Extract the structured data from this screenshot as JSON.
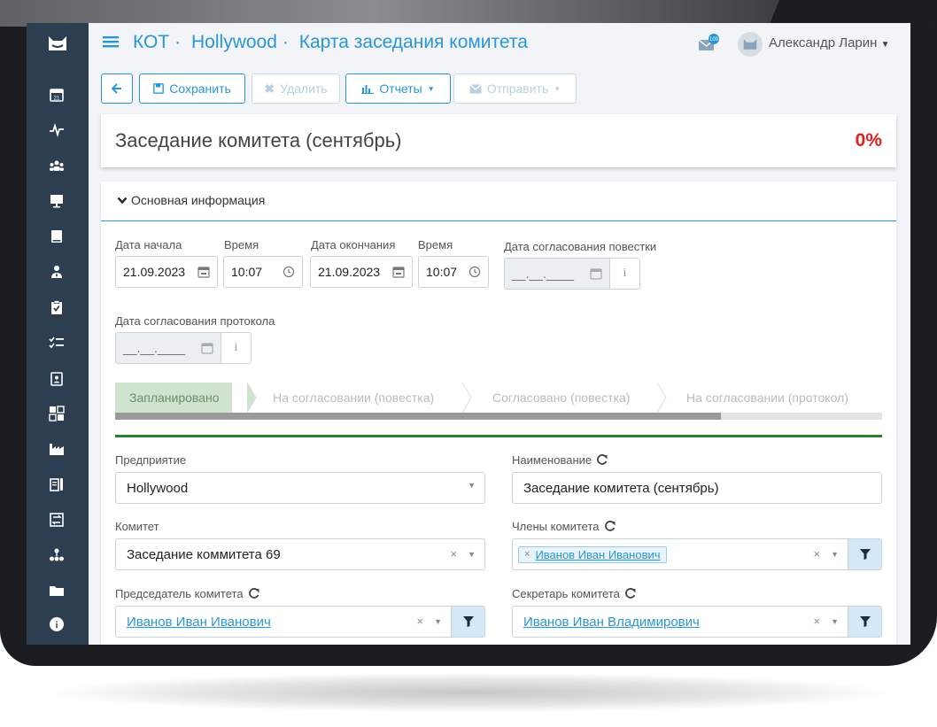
{
  "header": {
    "breadcrumb": [
      "КОТ",
      "Hollywood",
      "Карта заседания комитета"
    ],
    "mail_badge": "100",
    "user_name": "Александр Ларин"
  },
  "toolbar": {
    "save_label": "Сохранить",
    "delete_label": "Удалить",
    "reports_label": "Отчеты",
    "send_label": "Отправить"
  },
  "card": {
    "title": "Заседание комитета (сентябрь)",
    "progress_text": "0%"
  },
  "section": {
    "title": "Основная информация"
  },
  "dates": {
    "start_label": "Дата начала",
    "start_value": "21.09.2023",
    "time_label": "Время",
    "start_time": "10:07",
    "end_label": "Дата окончания",
    "end_value": "21.09.2023",
    "end_time_label": "Время",
    "end_time": "10:07",
    "agenda_label": "Дата согласования повестки",
    "agenda_placeholder": "__.__.____",
    "protocol_label": "Дата согласования протокола",
    "protocol_placeholder": "__.__.____"
  },
  "steps": [
    "Запланировано",
    "На согласовании (повестка)",
    "Согласовано (повестка)",
    "На согласовании (протокол)"
  ],
  "steps_progress": 0.79,
  "form": {
    "enterprise_label": "Предприятие",
    "enterprise_value": "Hollywood",
    "name_label": "Наименование",
    "name_value": "Заседание комитета (сентябрь)",
    "committee_label": "Комитет",
    "committee_value": "Заседание коммитета 69",
    "members_label": "Члены комитета",
    "members_value": "Иванов Иван Иванович",
    "chair_label": "Председатель комитета",
    "chair_value": "Иванов Иван Иванович",
    "secretary_label": "Секретарь комитета",
    "secretary_value": "Иванов Иван Владимирович"
  },
  "colors": {
    "accent": "#2a97d4",
    "sidebar": "#2c3e50",
    "progress_red": "#e02020",
    "active_step": "#cfe3cf",
    "divider_green": "#2e7d32"
  }
}
